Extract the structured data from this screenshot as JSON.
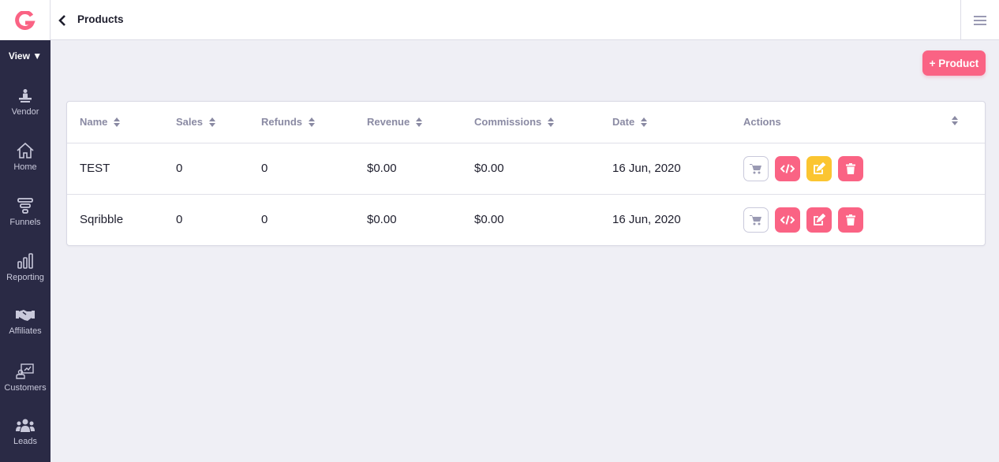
{
  "brand": {
    "logo_icon": "g-logo-icon",
    "accent": "#fa6384"
  },
  "sidebar": {
    "view_label": "View",
    "items": [
      {
        "label": "Vendor",
        "icon": "vendor-icon"
      },
      {
        "label": "Home",
        "icon": "home-icon"
      },
      {
        "label": "Funnels",
        "icon": "funnel-icon"
      },
      {
        "label": "Reporting",
        "icon": "bar-chart-icon"
      },
      {
        "label": "Affiliates",
        "icon": "handshake-icon"
      },
      {
        "label": "Customers",
        "icon": "customers-icon"
      },
      {
        "label": "Leads",
        "icon": "users-icon"
      }
    ]
  },
  "header": {
    "title": "Products",
    "back_icon": "chevron-left-icon",
    "menu_icon": "hamburger-icon"
  },
  "toolbar": {
    "add_product_label": "+ Product"
  },
  "table": {
    "columns": [
      "Name",
      "Sales",
      "Refunds",
      "Revenue",
      "Commissions",
      "Date",
      "Actions"
    ],
    "rows": [
      {
        "name": "TEST",
        "sales": "0",
        "refunds": "0",
        "revenue": "$0.00",
        "commissions": "$0.00",
        "date": "16 Jun, 2020",
        "edit_color": "#fbc531"
      },
      {
        "name": "Sqribble",
        "sales": "0",
        "refunds": "0",
        "revenue": "$0.00",
        "commissions": "$0.00",
        "date": "16 Jun, 2020",
        "edit_color": "#fa6384"
      }
    ],
    "action_icons": [
      "cart-icon",
      "code-icon",
      "edit-icon",
      "trash-icon"
    ]
  }
}
